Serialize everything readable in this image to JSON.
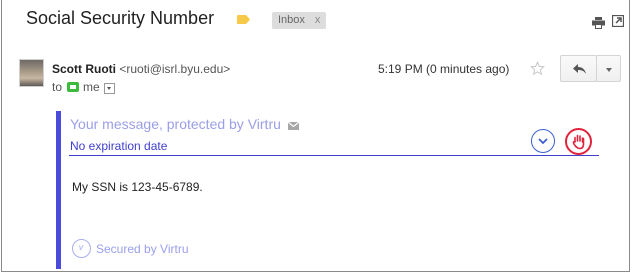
{
  "email": {
    "subject": "Social Security Number",
    "label_chip": "Inbox",
    "label_chip_close": "x",
    "label_color": "#f7c948"
  },
  "sender": {
    "name": "Scott Ruoti",
    "email": "<ruoti@isrl.byu.edu>",
    "to_prefix": "to",
    "recipient": "me",
    "time": "5:19 PM (0 minutes ago)"
  },
  "virtru": {
    "protected_title": "Your message, protected by Virtru",
    "expiration": "No expiration date",
    "secured_label": "Secured by Virtru",
    "logo_letter": "v",
    "accent_color": "#4b4bd9",
    "revoke_color": "#e0223a"
  },
  "message": {
    "body": "My SSN is 123-45-6789."
  },
  "icons": {
    "tag": "label-tag-icon",
    "print": "print-icon",
    "popout": "popout-icon",
    "star": "star-icon",
    "reply": "reply-icon",
    "more": "chevron-down-icon",
    "envelope": "envelope-icon",
    "chevron": "chevron-down-circle-icon",
    "revoke": "hand-stop-icon"
  }
}
